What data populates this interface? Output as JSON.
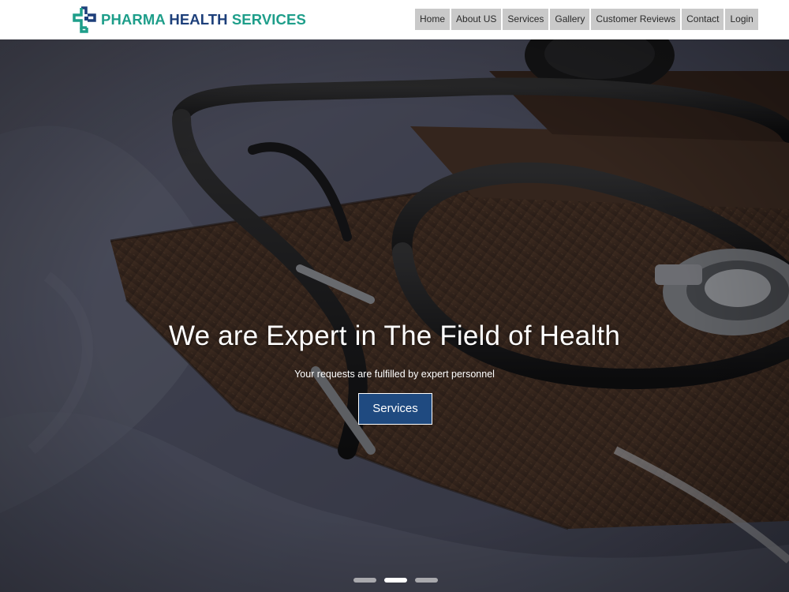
{
  "brand": {
    "logo_icon": "medical-cross-logo-icon",
    "name_part1": "PHARMA",
    "name_part2": "HEALTH",
    "name_part3": "SERVICES",
    "colors": {
      "teal": "#1e9e8a",
      "navy": "#1d3f7a"
    }
  },
  "nav": {
    "items": [
      {
        "label": "Home"
      },
      {
        "label": "About US"
      },
      {
        "label": "Services"
      },
      {
        "label": "Gallery"
      },
      {
        "label": "Customer Reviews"
      },
      {
        "label": "Contact"
      },
      {
        "label": "Login"
      }
    ]
  },
  "hero": {
    "title": "We are Expert in The Field of Health",
    "subtitle": "Your requests are fulfilled by expert personnel",
    "button_label": "Services",
    "button_color": "#1f4a80",
    "background_icon": "stethoscope-photo-background",
    "carousel": {
      "slides": 3,
      "active_index": 1
    }
  }
}
